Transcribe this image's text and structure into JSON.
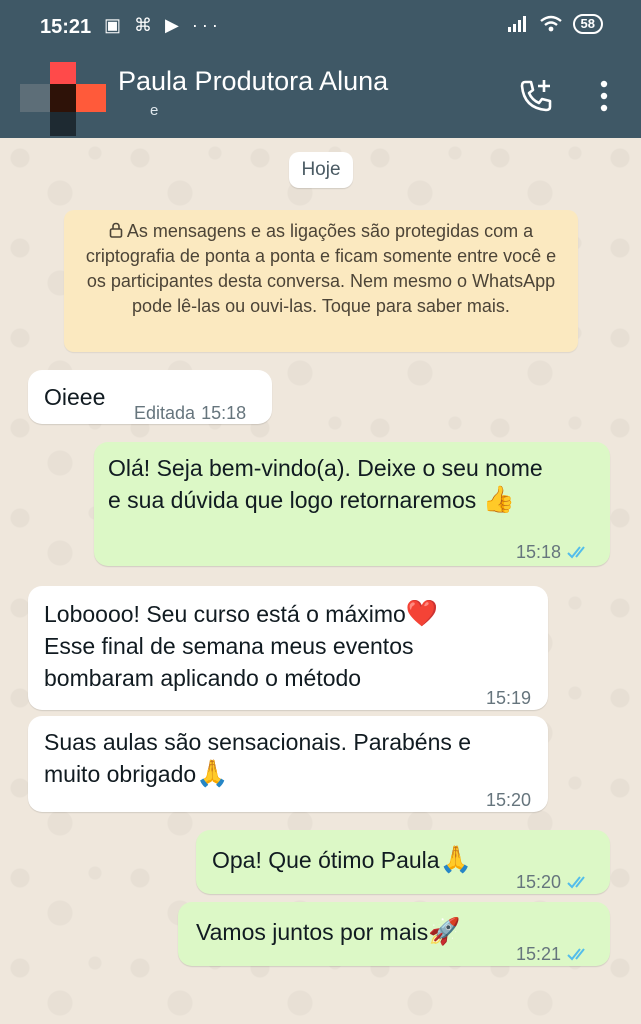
{
  "status_bar": {
    "time": "15:21",
    "left_icons": "▣ ⌘ ▶  ···",
    "battery": "58"
  },
  "header": {
    "contact_name": "Paula Produtora Aluna",
    "subtitle": "e"
  },
  "chat": {
    "date_chip": "Hoje",
    "encryption_notice": "As mensagens e as ligações são protegidas com a criptografia de ponta a ponta e ficam somente entre você e os participantes desta conversa. Nem mesmo o WhatsApp pode lê-las ou ouvi-las. Toque para saber mais.",
    "messages": [
      {
        "direction": "in",
        "text": "Oieee",
        "edited_label": "Editada",
        "time": "15:18"
      },
      {
        "direction": "out",
        "line1": "Olá! Seja bem-vindo(a). Deixe o seu nome",
        "line2": "e sua dúvida que logo retornaremos",
        "emoji": "👍",
        "time": "15:18",
        "read": true
      },
      {
        "direction": "in",
        "line1": "Loboooo! Seu curso está o máximo",
        "emoji": "❤️",
        "line2": "Esse final de semana meus eventos",
        "line3": "bombaram aplicando o método",
        "time": "15:19"
      },
      {
        "direction": "in",
        "line1": "Suas aulas são sensacionais. Parabéns e",
        "line2": "muito obrigado",
        "emoji": "🙏",
        "time": "15:20"
      },
      {
        "direction": "out",
        "text": "Opa! Que ótimo Paula",
        "emoji": "🙏",
        "time": "15:20",
        "read": true
      },
      {
        "direction": "out",
        "text": "Vamos juntos por mais",
        "emoji": "🚀",
        "time": "15:21",
        "read": true
      }
    ]
  },
  "colors": {
    "header": "#3f5866",
    "incoming": "#ffffff",
    "outgoing": "#dcf8c6",
    "notice": "#fbe9c0",
    "read_ticks": "#53bdeb"
  },
  "icons": [
    "add-call-icon",
    "more-vertical-icon",
    "lock-icon",
    "double-check-icon",
    "wifi-icon",
    "signal-icon",
    "battery-icon"
  ]
}
